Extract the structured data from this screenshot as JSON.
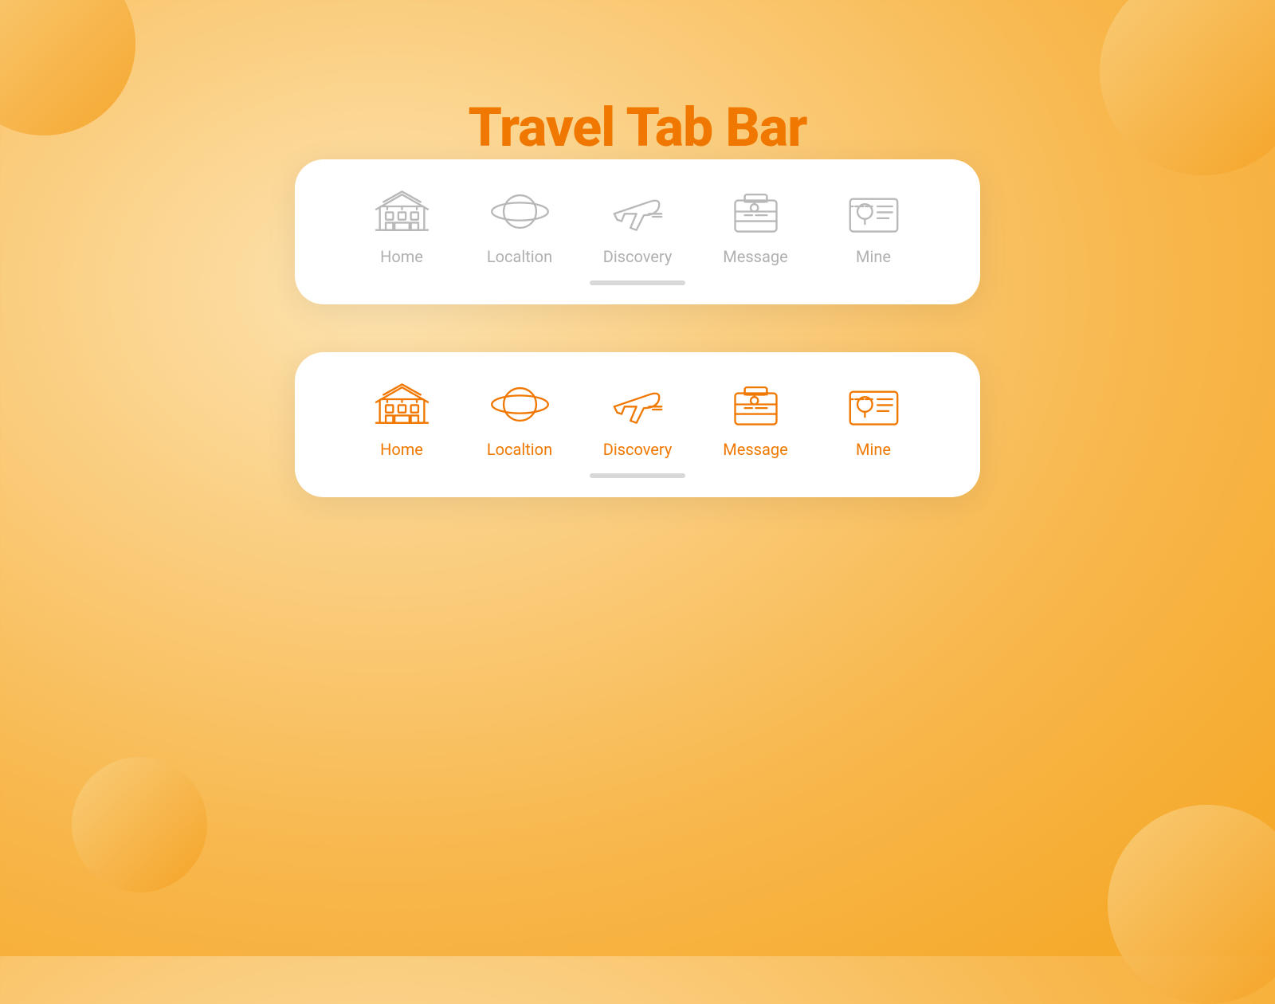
{
  "page": {
    "title": "Travel Tab Bar",
    "title_color": "#f07800"
  },
  "tabbar_inactive": {
    "tabs": [
      {
        "id": "home",
        "label": "Home"
      },
      {
        "id": "location",
        "label": "Localtion"
      },
      {
        "id": "discovery",
        "label": "Discovery"
      },
      {
        "id": "message",
        "label": "Message"
      },
      {
        "id": "mine",
        "label": "Mine"
      }
    ]
  },
  "tabbar_active": {
    "tabs": [
      {
        "id": "home",
        "label": "Home"
      },
      {
        "id": "location",
        "label": "Localtion"
      },
      {
        "id": "discovery",
        "label": "Discovery"
      },
      {
        "id": "message",
        "label": "Message"
      },
      {
        "id": "mine",
        "label": "Mine"
      }
    ]
  }
}
